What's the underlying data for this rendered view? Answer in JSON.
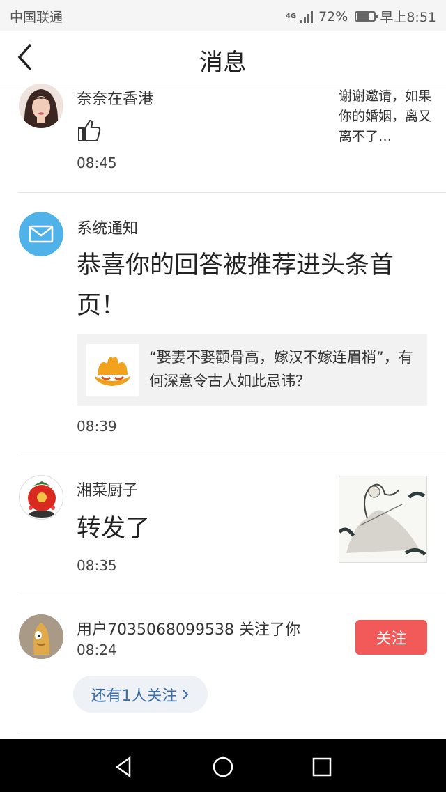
{
  "status": {
    "carrier": "中国联通",
    "network": "4G",
    "battery": "72%",
    "battery_level": 0.72,
    "time": "早上8:51"
  },
  "header": {
    "title": "消息"
  },
  "items": [
    {
      "name": "奈奈在香港",
      "time": "08:45",
      "preview": "谢谢邀请，如果你的婚姻，离又离不了…"
    },
    {
      "name": "系统通知",
      "message": "恭喜你的回答被推荐进头条首页！",
      "quote": "“娶妻不娶颧骨高，嫁汉不嫁连眉梢”，有何深意令古人如此忌讳？",
      "time": "08:39"
    },
    {
      "name": "湘菜厨子",
      "action": "转发了",
      "time": "08:35"
    },
    {
      "name": "用户7035068099538 关注了你",
      "time": "08:24",
      "follow_label": "关注",
      "more_label": "还有1人关注"
    }
  ],
  "colors": {
    "accent_red": "#f25a5a",
    "link_blue": "#3c6ea8",
    "mail_blue": "#4fb3ea"
  }
}
